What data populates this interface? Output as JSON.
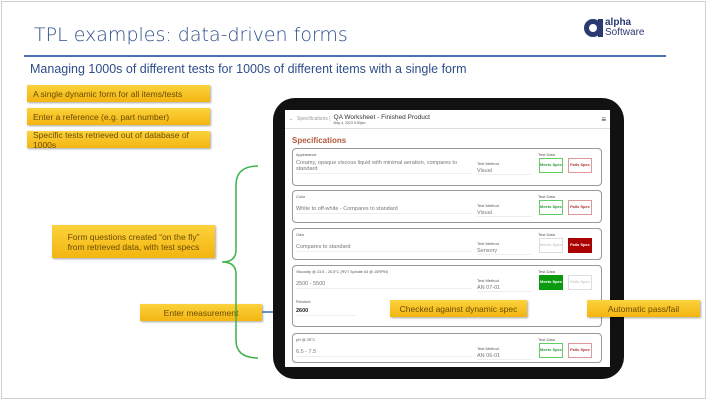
{
  "slide": {
    "title": "TPL examples: data-driven forms",
    "subtitle": "Managing 1000s of different tests for 1000s of different items with a single form",
    "logo": "alpha Software"
  },
  "callouts": {
    "c1": "A single dynamic form for all items/tests",
    "c2": "Enter a reference (e.g. part number)",
    "c3": "Specific tests retrieved out of database of 1000s",
    "c4": "Form questions created “on the fly” from retrieved data, with test specs",
    "c5": "Enter measurement",
    "c6": "Checked against dynamic spec",
    "c7": "Automatic pass/fail"
  },
  "colors": {
    "callout": "#f7c21f",
    "title": "#2d4e8a",
    "meets": "#0a9a10",
    "fails": "#a00000"
  },
  "app": {
    "back": "←",
    "breadcrumb": "Specifications |",
    "title": "QA Worksheet - Finished Product",
    "date": "May 4, 2023 9:30pm",
    "menu_icon": "≡",
    "section": "Specifications",
    "test_method_label": "Test Method",
    "test_data_label": "Test Data",
    "meets": "Meets Spec",
    "fails": "Fails Spec",
    "cards": [
      {
        "label": "Appearance",
        "value": "Creamy, opaque viscous liquid with minimal aeration, compares to standard",
        "method": "Visual",
        "state": "none"
      },
      {
        "label": "Color",
        "value": "White to off-white - Compares to standard",
        "method": "Visual",
        "state": "none"
      },
      {
        "label": "Odor",
        "value": "Compares to standard",
        "method": "Sensory",
        "state": "fails"
      },
      {
        "label": "Viscosity @ 23.5 - 26.5°C (RVT Spindle #3 @ 10RPM)",
        "value": "2500 - 5500",
        "method": "AN 07-01",
        "state": "meets",
        "finished_label": "Finished",
        "finished_value": "2600"
      },
      {
        "label": "pH @ 25°C",
        "value": "6.5 - 7.5",
        "method": "AN 06-01",
        "state": "none"
      }
    ]
  }
}
